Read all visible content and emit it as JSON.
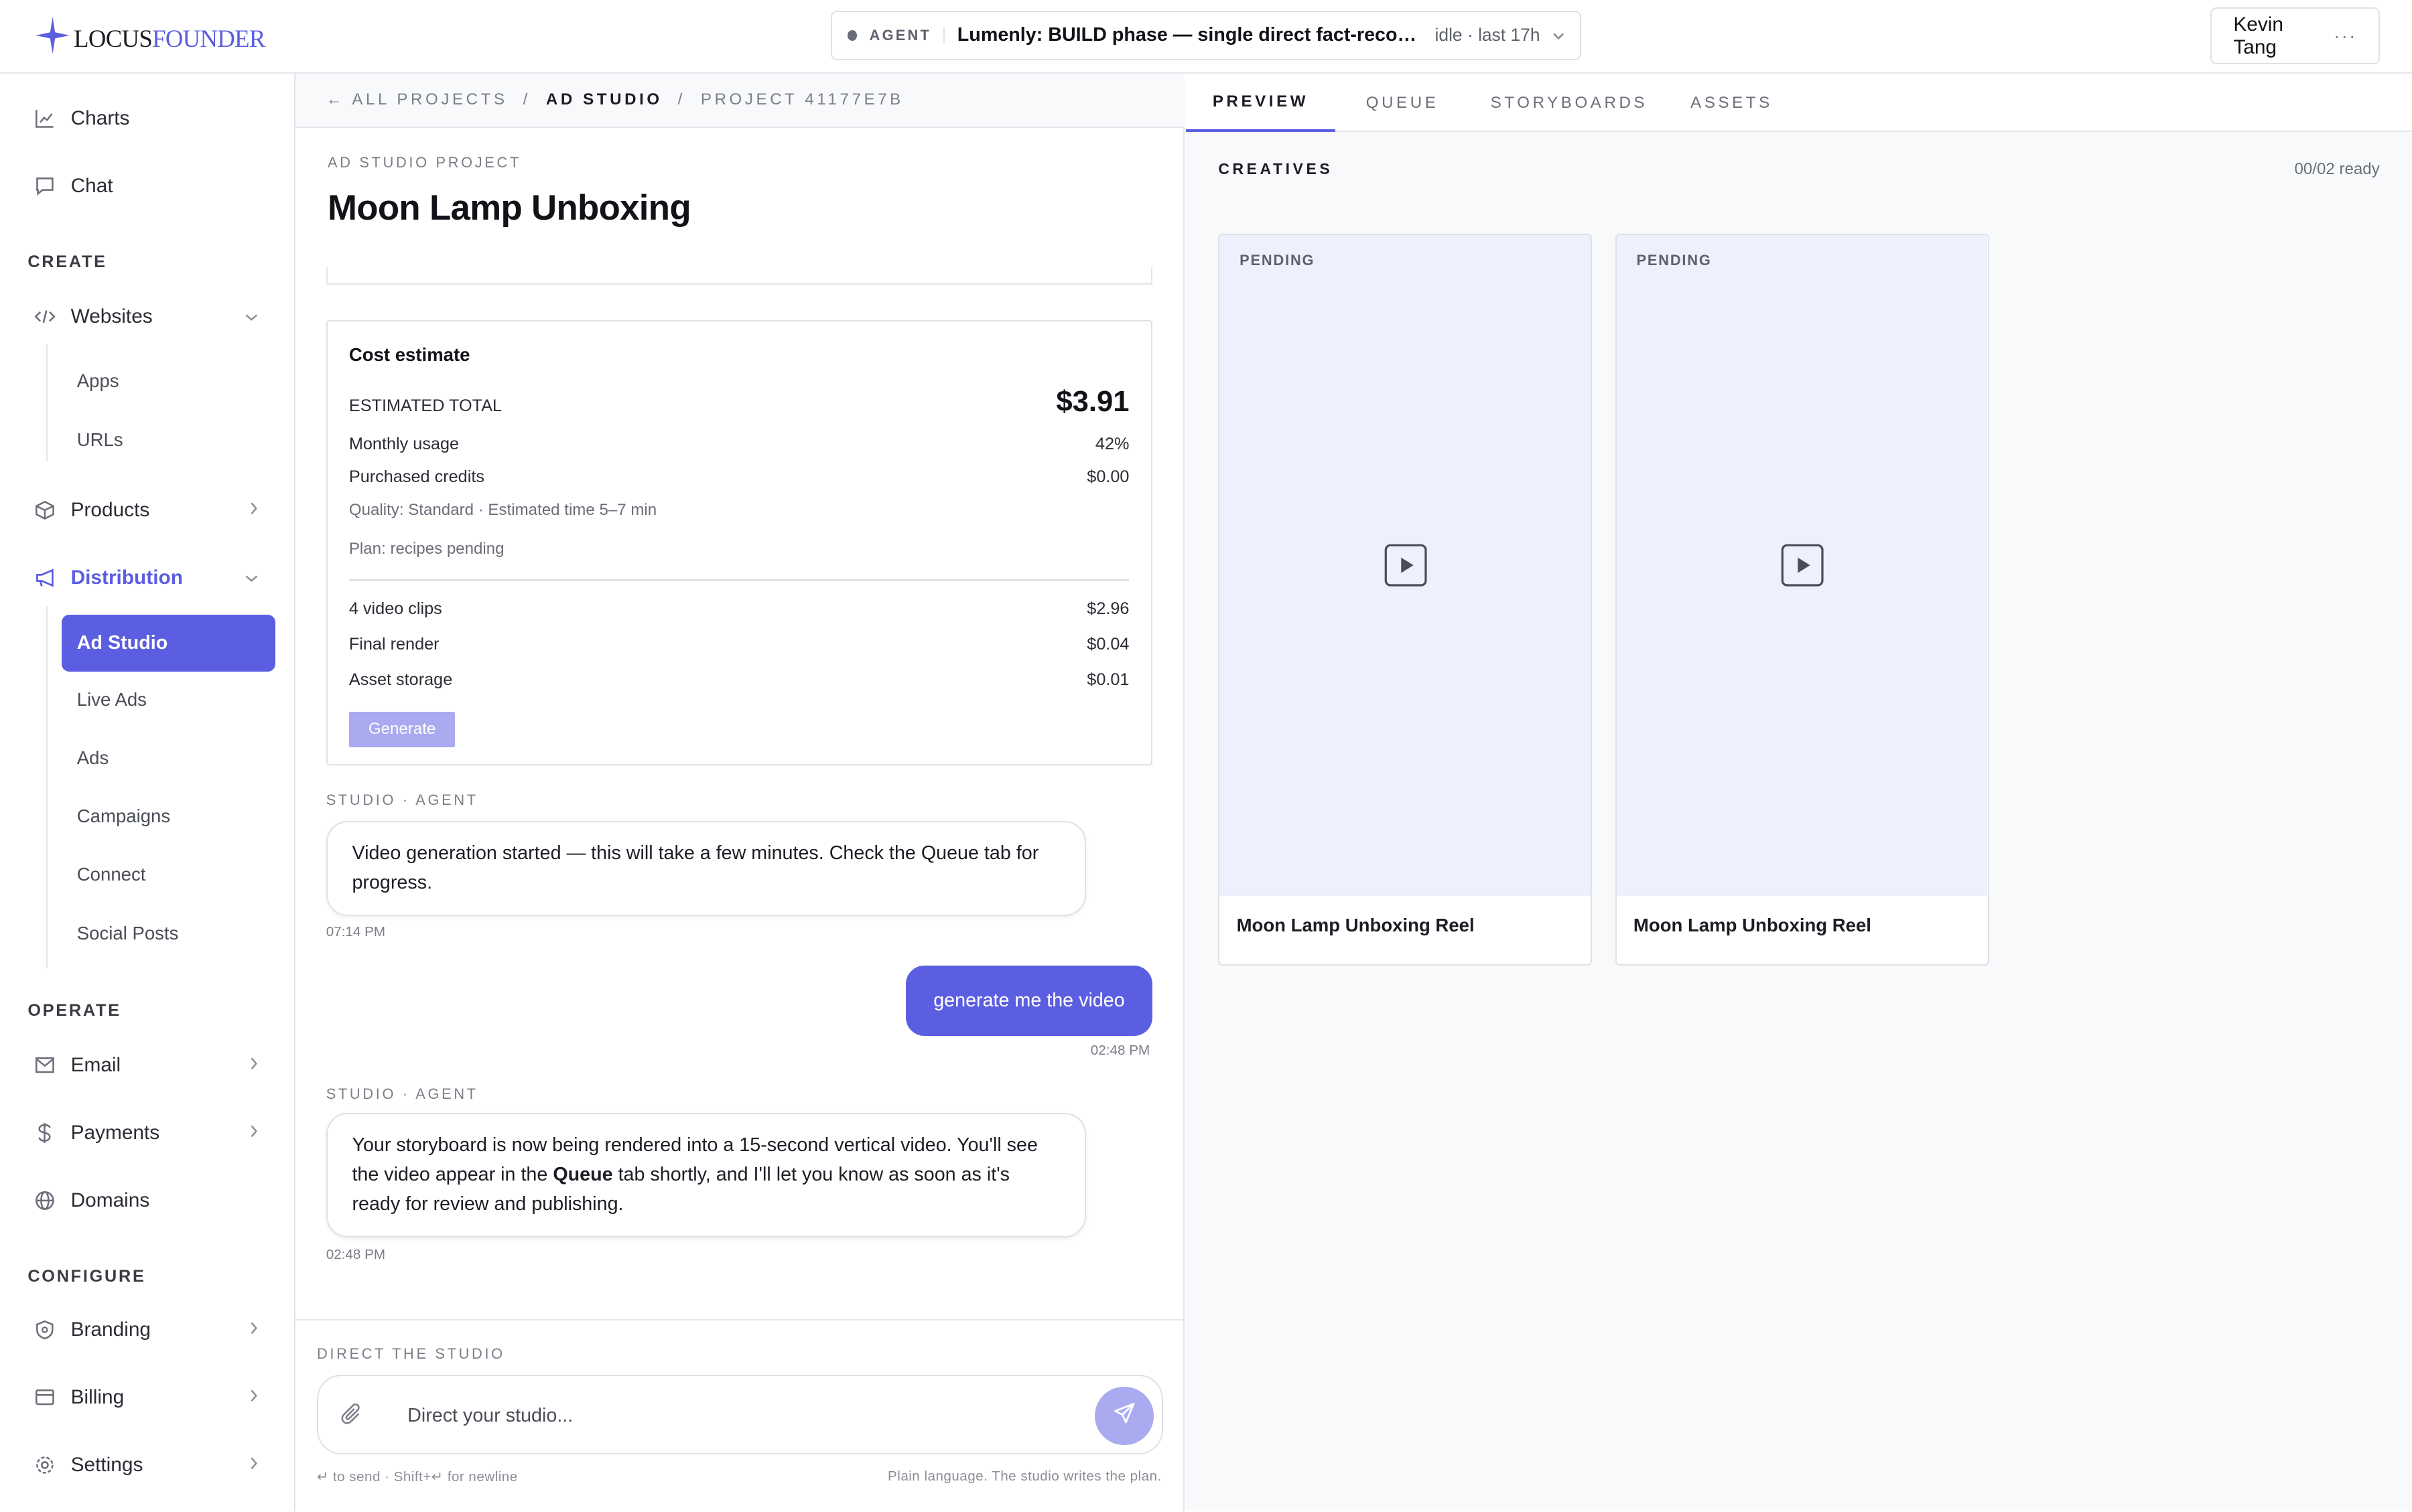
{
  "brand": {
    "name_part1": "LOCUS",
    "name_part2": "FOUNDER",
    "accent": "#5b5ee0"
  },
  "agent": {
    "label": "AGENT",
    "title": "Lumenly: BUILD phase — single direct fact-recording …",
    "status": "idle · last 17h"
  },
  "user": {
    "name": "Kevin Tang",
    "more": "···"
  },
  "sidebar": {
    "top_items": [
      {
        "label": "Charts",
        "icon": "chart-icon"
      },
      {
        "label": "Chat",
        "icon": "chat-icon"
      }
    ],
    "sections": {
      "create": "CREATE",
      "operate": "OPERATE",
      "configure": "CONFIGURE"
    },
    "create_items": {
      "websites": "Websites",
      "websites_sub": [
        "Apps",
        "URLs"
      ],
      "products": "Products",
      "distribution": "Distribution",
      "distribution_sub": [
        "Ad Studio",
        "Live Ads",
        "Ads",
        "Campaigns",
        "Connect",
        "Social Posts"
      ]
    },
    "operate_items": [
      "Email",
      "Payments",
      "Domains"
    ],
    "configure_items": [
      "Branding",
      "Billing",
      "Settings"
    ]
  },
  "breadcrumb": {
    "back": "← ALL PROJECTS",
    "sep": "/",
    "section": "AD STUDIO",
    "project": "PROJECT 41177E7B"
  },
  "project": {
    "label": "AD STUDIO PROJECT",
    "title": "Moon Lamp Unboxing"
  },
  "cost": {
    "title": "Cost estimate",
    "total_label": "ESTIMATED TOTAL",
    "total_value": "$3.91",
    "monthly_label": "Monthly usage",
    "monthly_value": "42%",
    "credits_label": "Purchased credits",
    "credits_value": "$0.00",
    "quality": "Quality: Standard · Estimated time 5–7 min",
    "plan": "Plan: recipes pending",
    "lines": [
      {
        "label": "4 video clips",
        "value": "$2.96"
      },
      {
        "label": "Final render",
        "value": "$0.04"
      },
      {
        "label": "Asset storage",
        "value": "$0.01"
      }
    ],
    "generate_label": "Generate"
  },
  "messages": {
    "m1": {
      "sender": "STUDIO · AGENT",
      "text": "Video generation started — this will take a few minutes. Check the Queue tab for progress.",
      "time": "07:14 PM"
    },
    "m2": {
      "text": "generate me the video",
      "time": "02:48 PM"
    },
    "m3": {
      "sender": "STUDIO · AGENT",
      "text_before": "Your storyboard is now being rendered into a 15-second vertical video. You'll see the video appear in the ",
      "bold": "Queue",
      "text_after": " tab shortly, and I'll let you know as soon as it's ready for review and publishing.",
      "time": "02:48 PM"
    }
  },
  "composer": {
    "label": "DIRECT THE STUDIO",
    "placeholder": "Direct your studio...",
    "hint_left": "↵ to send · Shift+↵ for newline",
    "hint_right": "Plain language. The studio writes the plan."
  },
  "tabs": [
    "PREVIEW",
    "QUEUE",
    "STORYBOARDS",
    "ASSETS"
  ],
  "creatives": {
    "label": "CREATIVES",
    "ready": "00/02 ready",
    "items": [
      {
        "status": "PENDING",
        "title": "Moon Lamp Unboxing Reel"
      },
      {
        "status": "PENDING",
        "title": "Moon Lamp Unboxing Reel"
      }
    ]
  }
}
